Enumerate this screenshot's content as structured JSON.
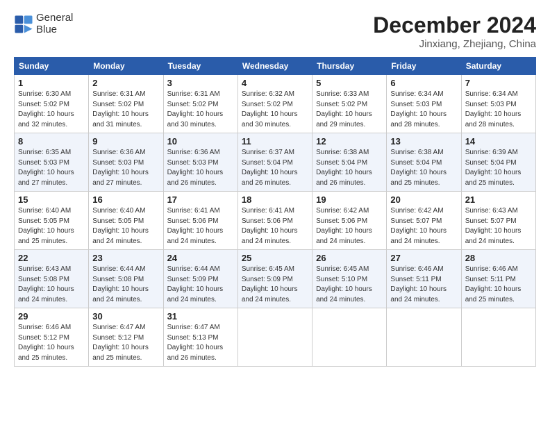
{
  "logo": {
    "line1": "General",
    "line2": "Blue"
  },
  "title": "December 2024",
  "subtitle": "Jinxiang, Zhejiang, China",
  "headers": [
    "Sunday",
    "Monday",
    "Tuesday",
    "Wednesday",
    "Thursday",
    "Friday",
    "Saturday"
  ],
  "weeks": [
    [
      {
        "day": "1",
        "info": "Sunrise: 6:30 AM\nSunset: 5:02 PM\nDaylight: 10 hours\nand 32 minutes."
      },
      {
        "day": "2",
        "info": "Sunrise: 6:31 AM\nSunset: 5:02 PM\nDaylight: 10 hours\nand 31 minutes."
      },
      {
        "day": "3",
        "info": "Sunrise: 6:31 AM\nSunset: 5:02 PM\nDaylight: 10 hours\nand 30 minutes."
      },
      {
        "day": "4",
        "info": "Sunrise: 6:32 AM\nSunset: 5:02 PM\nDaylight: 10 hours\nand 30 minutes."
      },
      {
        "day": "5",
        "info": "Sunrise: 6:33 AM\nSunset: 5:02 PM\nDaylight: 10 hours\nand 29 minutes."
      },
      {
        "day": "6",
        "info": "Sunrise: 6:34 AM\nSunset: 5:03 PM\nDaylight: 10 hours\nand 28 minutes."
      },
      {
        "day": "7",
        "info": "Sunrise: 6:34 AM\nSunset: 5:03 PM\nDaylight: 10 hours\nand 28 minutes."
      }
    ],
    [
      {
        "day": "8",
        "info": "Sunrise: 6:35 AM\nSunset: 5:03 PM\nDaylight: 10 hours\nand 27 minutes."
      },
      {
        "day": "9",
        "info": "Sunrise: 6:36 AM\nSunset: 5:03 PM\nDaylight: 10 hours\nand 27 minutes."
      },
      {
        "day": "10",
        "info": "Sunrise: 6:36 AM\nSunset: 5:03 PM\nDaylight: 10 hours\nand 26 minutes."
      },
      {
        "day": "11",
        "info": "Sunrise: 6:37 AM\nSunset: 5:04 PM\nDaylight: 10 hours\nand 26 minutes."
      },
      {
        "day": "12",
        "info": "Sunrise: 6:38 AM\nSunset: 5:04 PM\nDaylight: 10 hours\nand 26 minutes."
      },
      {
        "day": "13",
        "info": "Sunrise: 6:38 AM\nSunset: 5:04 PM\nDaylight: 10 hours\nand 25 minutes."
      },
      {
        "day": "14",
        "info": "Sunrise: 6:39 AM\nSunset: 5:04 PM\nDaylight: 10 hours\nand 25 minutes."
      }
    ],
    [
      {
        "day": "15",
        "info": "Sunrise: 6:40 AM\nSunset: 5:05 PM\nDaylight: 10 hours\nand 25 minutes."
      },
      {
        "day": "16",
        "info": "Sunrise: 6:40 AM\nSunset: 5:05 PM\nDaylight: 10 hours\nand 24 minutes."
      },
      {
        "day": "17",
        "info": "Sunrise: 6:41 AM\nSunset: 5:06 PM\nDaylight: 10 hours\nand 24 minutes."
      },
      {
        "day": "18",
        "info": "Sunrise: 6:41 AM\nSunset: 5:06 PM\nDaylight: 10 hours\nand 24 minutes."
      },
      {
        "day": "19",
        "info": "Sunrise: 6:42 AM\nSunset: 5:06 PM\nDaylight: 10 hours\nand 24 minutes."
      },
      {
        "day": "20",
        "info": "Sunrise: 6:42 AM\nSunset: 5:07 PM\nDaylight: 10 hours\nand 24 minutes."
      },
      {
        "day": "21",
        "info": "Sunrise: 6:43 AM\nSunset: 5:07 PM\nDaylight: 10 hours\nand 24 minutes."
      }
    ],
    [
      {
        "day": "22",
        "info": "Sunrise: 6:43 AM\nSunset: 5:08 PM\nDaylight: 10 hours\nand 24 minutes."
      },
      {
        "day": "23",
        "info": "Sunrise: 6:44 AM\nSunset: 5:08 PM\nDaylight: 10 hours\nand 24 minutes."
      },
      {
        "day": "24",
        "info": "Sunrise: 6:44 AM\nSunset: 5:09 PM\nDaylight: 10 hours\nand 24 minutes."
      },
      {
        "day": "25",
        "info": "Sunrise: 6:45 AM\nSunset: 5:09 PM\nDaylight: 10 hours\nand 24 minutes."
      },
      {
        "day": "26",
        "info": "Sunrise: 6:45 AM\nSunset: 5:10 PM\nDaylight: 10 hours\nand 24 minutes."
      },
      {
        "day": "27",
        "info": "Sunrise: 6:46 AM\nSunset: 5:11 PM\nDaylight: 10 hours\nand 24 minutes."
      },
      {
        "day": "28",
        "info": "Sunrise: 6:46 AM\nSunset: 5:11 PM\nDaylight: 10 hours\nand 25 minutes."
      }
    ],
    [
      {
        "day": "29",
        "info": "Sunrise: 6:46 AM\nSunset: 5:12 PM\nDaylight: 10 hours\nand 25 minutes."
      },
      {
        "day": "30",
        "info": "Sunrise: 6:47 AM\nSunset: 5:12 PM\nDaylight: 10 hours\nand 25 minutes."
      },
      {
        "day": "31",
        "info": "Sunrise: 6:47 AM\nSunset: 5:13 PM\nDaylight: 10 hours\nand 26 minutes."
      },
      null,
      null,
      null,
      null
    ]
  ]
}
